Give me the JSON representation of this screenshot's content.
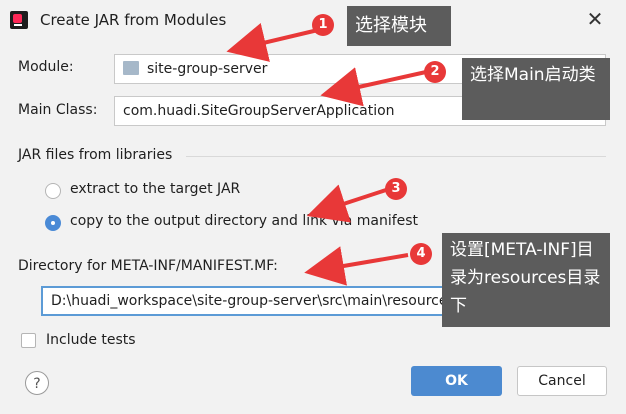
{
  "window": {
    "title": "Create JAR from Modules",
    "close_glyph": "✕"
  },
  "module": {
    "label": "Module:",
    "value": "site-group-server"
  },
  "main_class": {
    "label": "Main Class:",
    "value": "com.huadi.SiteGroupServerApplication"
  },
  "libraries": {
    "section_label": "JAR files from libraries",
    "option_extract": "extract to the target JAR",
    "option_copy": "copy to the output directory and link via manifest",
    "selected": "copy"
  },
  "manifest": {
    "label": "Directory for META-INF/MANIFEST.MF:",
    "value": "D:\\huadi_workspace\\site-group-server\\src\\main\\resources"
  },
  "include_tests": {
    "label": "Include tests",
    "checked": false
  },
  "buttons": {
    "help": "?",
    "ok": "OK",
    "cancel": "Cancel"
  },
  "annotations": {
    "badge_1": "1",
    "callout_1": "选择模块",
    "badge_2": "2",
    "callout_2": "选择Main启动类",
    "badge_3": "3",
    "badge_4": "4",
    "callout_4": "设置[META-INF]目录为resources目录下"
  },
  "colors": {
    "accent": "#4c8ad0",
    "annotation_red": "#e83838",
    "callout_bg": "#5c5c5c"
  }
}
